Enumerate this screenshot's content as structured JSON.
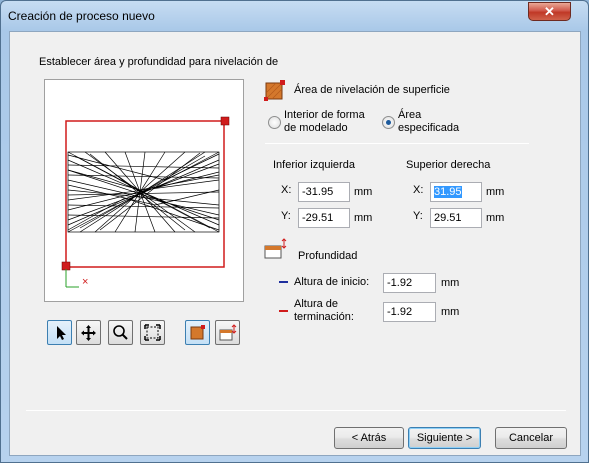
{
  "window": {
    "title": "Creación de proceso nuevo",
    "close_label": "✕"
  },
  "heading": "Establecer área y profundidad para nivelación de",
  "section_area": {
    "title": "Área de nivelación de superficie",
    "options": [
      {
        "label_line1": "Interior de forma",
        "label_line2": "de modelado",
        "selected": false
      },
      {
        "label_line1": "Área",
        "label_line2": "especificada",
        "selected": true
      }
    ]
  },
  "coords": {
    "lower_left": {
      "title": "Inferior izquierda",
      "x_label": "X:",
      "x": "-31.95",
      "y_label": "Y:",
      "y": "-29.51",
      "unit": "mm"
    },
    "upper_right": {
      "title": "Superior derecha",
      "x_label": "X:",
      "x": "31.95",
      "y_label": "Y:",
      "y": "29.51",
      "unit": "mm"
    }
  },
  "depth": {
    "title": "Profundidad",
    "start_label": "Altura de inicio:",
    "start_value": "-1.92",
    "end_label_line1": "Altura de",
    "end_label_line2": "terminación:",
    "end_value": "-1.92",
    "unit": "mm",
    "start_color": "#1f2f9e",
    "end_color": "#d01c1c"
  },
  "buttons": {
    "back": "< Atrás",
    "next": "Siguiente >",
    "cancel": "Cancelar"
  },
  "preview": {
    "axis_marker": "×"
  },
  "colors": {
    "selection_border": "#d01c1c",
    "accent": "#3399ff"
  }
}
